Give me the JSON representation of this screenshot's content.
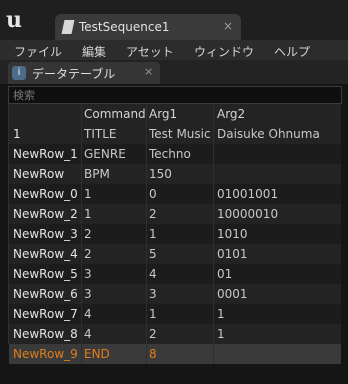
{
  "window": {
    "tab_title": "TestSequence1",
    "tab_close": "×"
  },
  "menu": [
    "ファイル",
    "編集",
    "アセット",
    "ウィンドウ",
    "ヘルプ"
  ],
  "panel": {
    "tab_label": "データテーブル",
    "tab_close": "×",
    "tab_icon_glyph": "🔍"
  },
  "search": {
    "placeholder": "検索",
    "value": ""
  },
  "table": {
    "columns": [
      "",
      "Command",
      "Arg1",
      "Arg2"
    ],
    "rows": [
      [
        "1",
        "TITLE",
        "Test Music",
        "Daisuke Ohnuma"
      ],
      [
        "NewRow_1",
        "GENRE",
        "Techno",
        ""
      ],
      [
        "NewRow",
        "BPM",
        "150",
        ""
      ],
      [
        "NewRow_0",
        "1",
        "0",
        "01001001"
      ],
      [
        "NewRow_2",
        "1",
        "2",
        "10000010"
      ],
      [
        "NewRow_3",
        "2",
        "1",
        "1010"
      ],
      [
        "NewRow_4",
        "2",
        "5",
        "0101"
      ],
      [
        "NewRow_5",
        "3",
        "4",
        "01"
      ],
      [
        "NewRow_6",
        "3",
        "3",
        "0001"
      ],
      [
        "NewRow_7",
        "4",
        "1",
        "1"
      ],
      [
        "NewRow_8",
        "4",
        "2",
        "1"
      ],
      [
        "NewRow_9",
        "END",
        "8",
        ""
      ]
    ],
    "selected_row_index": 11
  },
  "colors": {
    "selected_text": "#e07d1b",
    "background": "#151515",
    "row_even": "#1c1c1c",
    "row_odd": "#232323"
  }
}
